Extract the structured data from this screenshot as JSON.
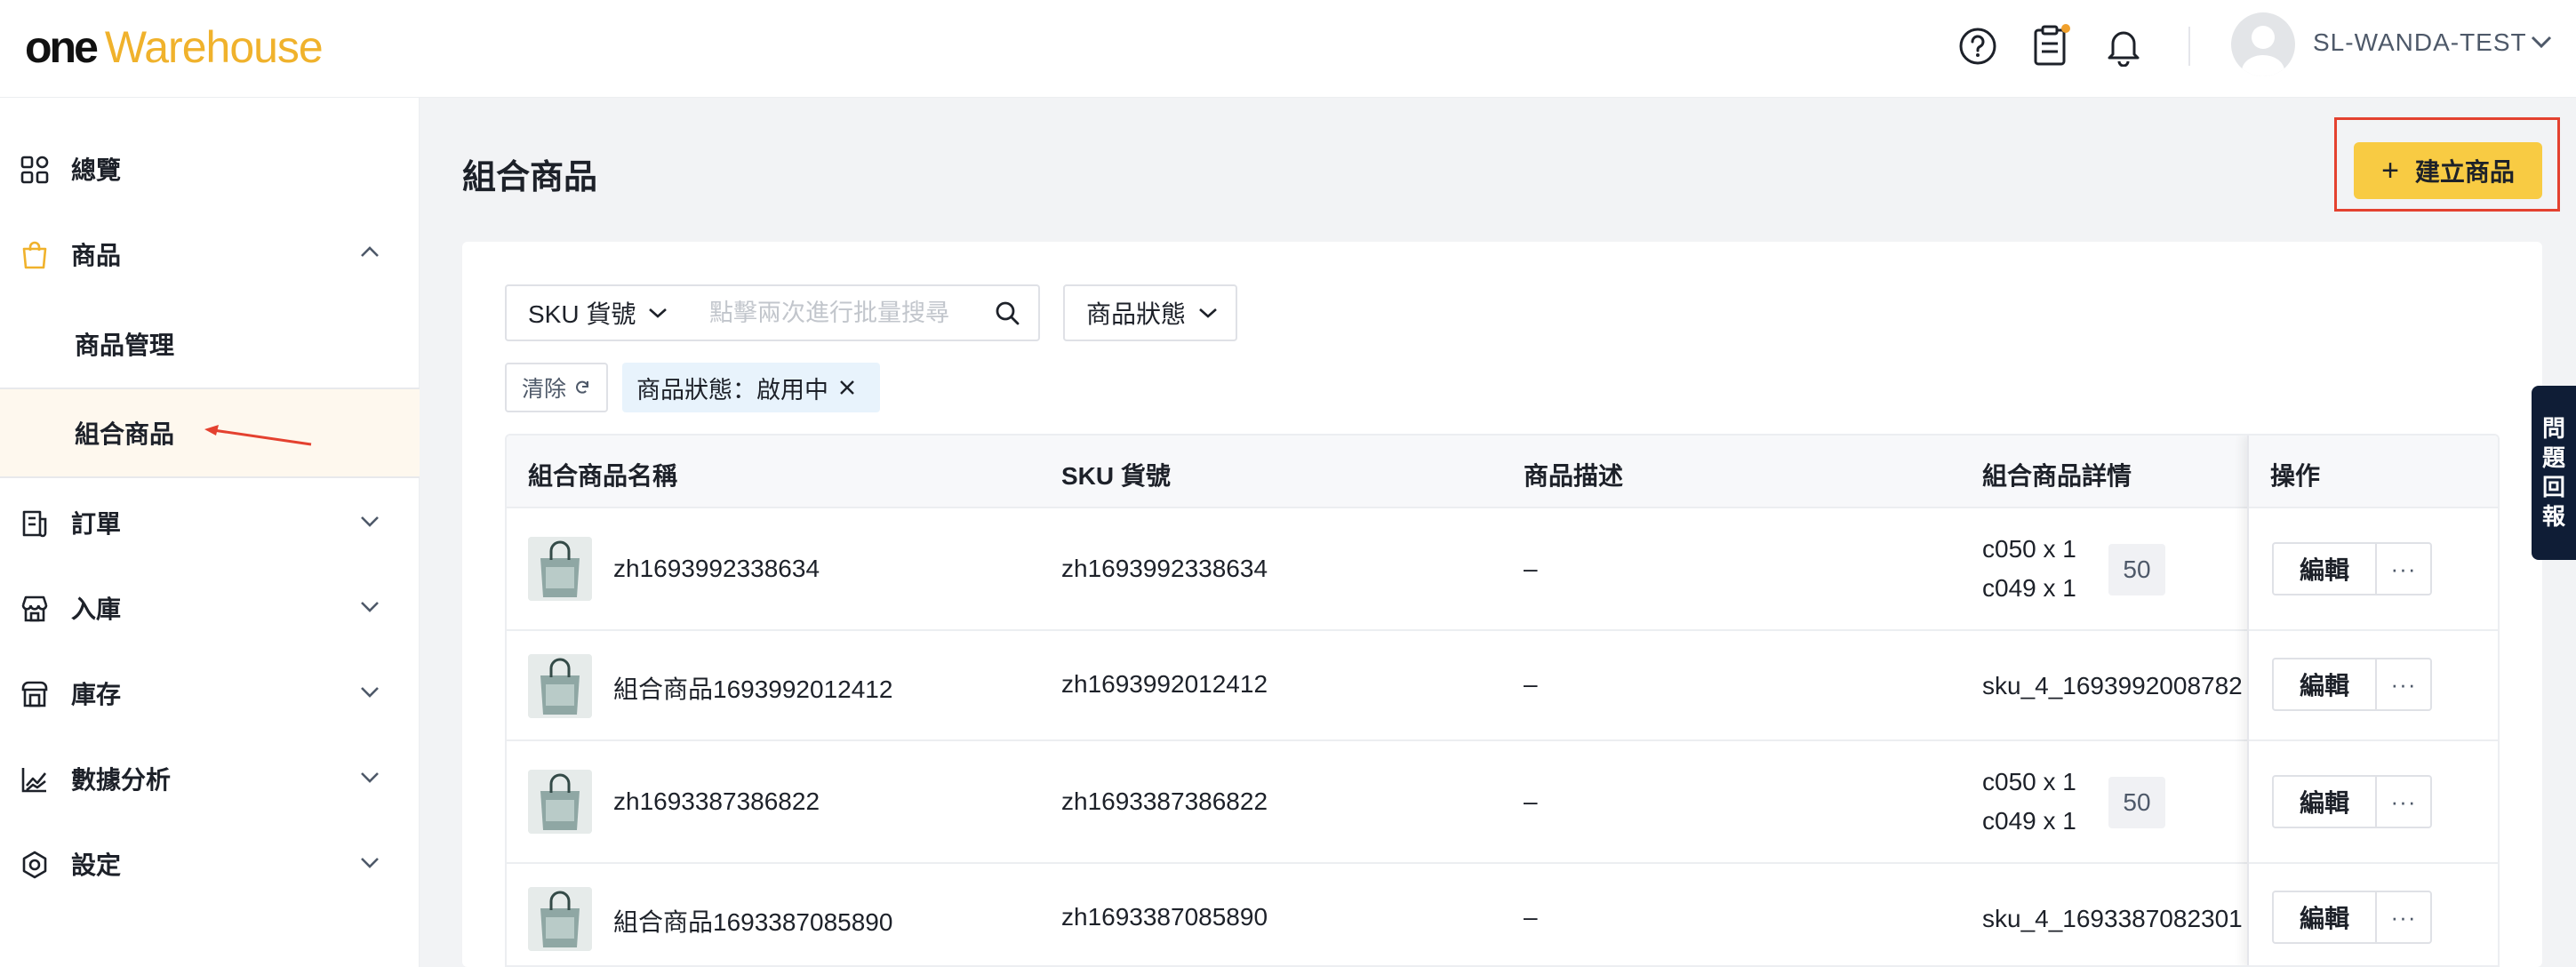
{
  "header": {
    "logo_one": "one",
    "logo_warehouse": "Warehouse",
    "username": "SL-WANDA-TEST",
    "icons": [
      "help-circle-icon",
      "clipboard-icon",
      "bell-icon",
      "avatar",
      "chevron-down-icon"
    ],
    "accent_color": "#f0b22c",
    "notification_dot_color": "#f0a02c"
  },
  "sidebar": {
    "items": [
      {
        "label": "總覽",
        "icon": "dashboard-grid-icon"
      },
      {
        "label": "商品",
        "icon": "shopping-bag-icon",
        "expanded": true,
        "children": [
          {
            "label": "商品管理"
          },
          {
            "label": "組合商品",
            "active": true
          }
        ]
      },
      {
        "label": "訂單",
        "icon": "receipt-icon"
      },
      {
        "label": "入庫",
        "icon": "store-icon"
      },
      {
        "label": "庫存",
        "icon": "inventory-icon"
      },
      {
        "label": "數據分析",
        "icon": "chart-line-icon"
      },
      {
        "label": "設定",
        "icon": "hexagon-gear-icon"
      }
    ],
    "active_bg_color": "#fef8ee"
  },
  "page": {
    "title": "組合商品",
    "create_button": {
      "icon": "+",
      "label": "建立商品",
      "color": "#f8cb43"
    }
  },
  "filters": {
    "sku_select": "SKU 貨號",
    "search_placeholder": "點擊兩次進行批量搜尋",
    "status_select": "商品狀態",
    "clear_label": "清除",
    "active_tag": "商品狀態：啟用中"
  },
  "table": {
    "columns": [
      "組合商品名稱",
      "SKU 貨號",
      "商品描述",
      "組合商品詳情",
      "操作"
    ],
    "rows": [
      {
        "name": "zh1693992338634",
        "sku": "zh1693992338634",
        "desc": "–",
        "details": [
          "c050 x 1",
          "c049 x 1"
        ],
        "qty": "50"
      },
      {
        "name": "組合商品1693992012412",
        "sku": "zh1693992012412",
        "desc": "–",
        "details": [
          "sku_4_1693992008782"
        ],
        "qty": ""
      },
      {
        "name": "zh1693387386822",
        "sku": "zh1693387386822",
        "desc": "–",
        "details": [
          "c050 x 1",
          "c049 x 1"
        ],
        "qty": "50"
      },
      {
        "name": "組合商品1693387085890",
        "sku": "zh1693387085890",
        "desc": "–",
        "details": [
          "sku_4_1693387082301"
        ],
        "qty": ""
      }
    ],
    "edit_label": "編輯",
    "more_label": "···"
  },
  "feedback": {
    "chars": [
      "問",
      "題",
      "回",
      "報"
    ]
  }
}
